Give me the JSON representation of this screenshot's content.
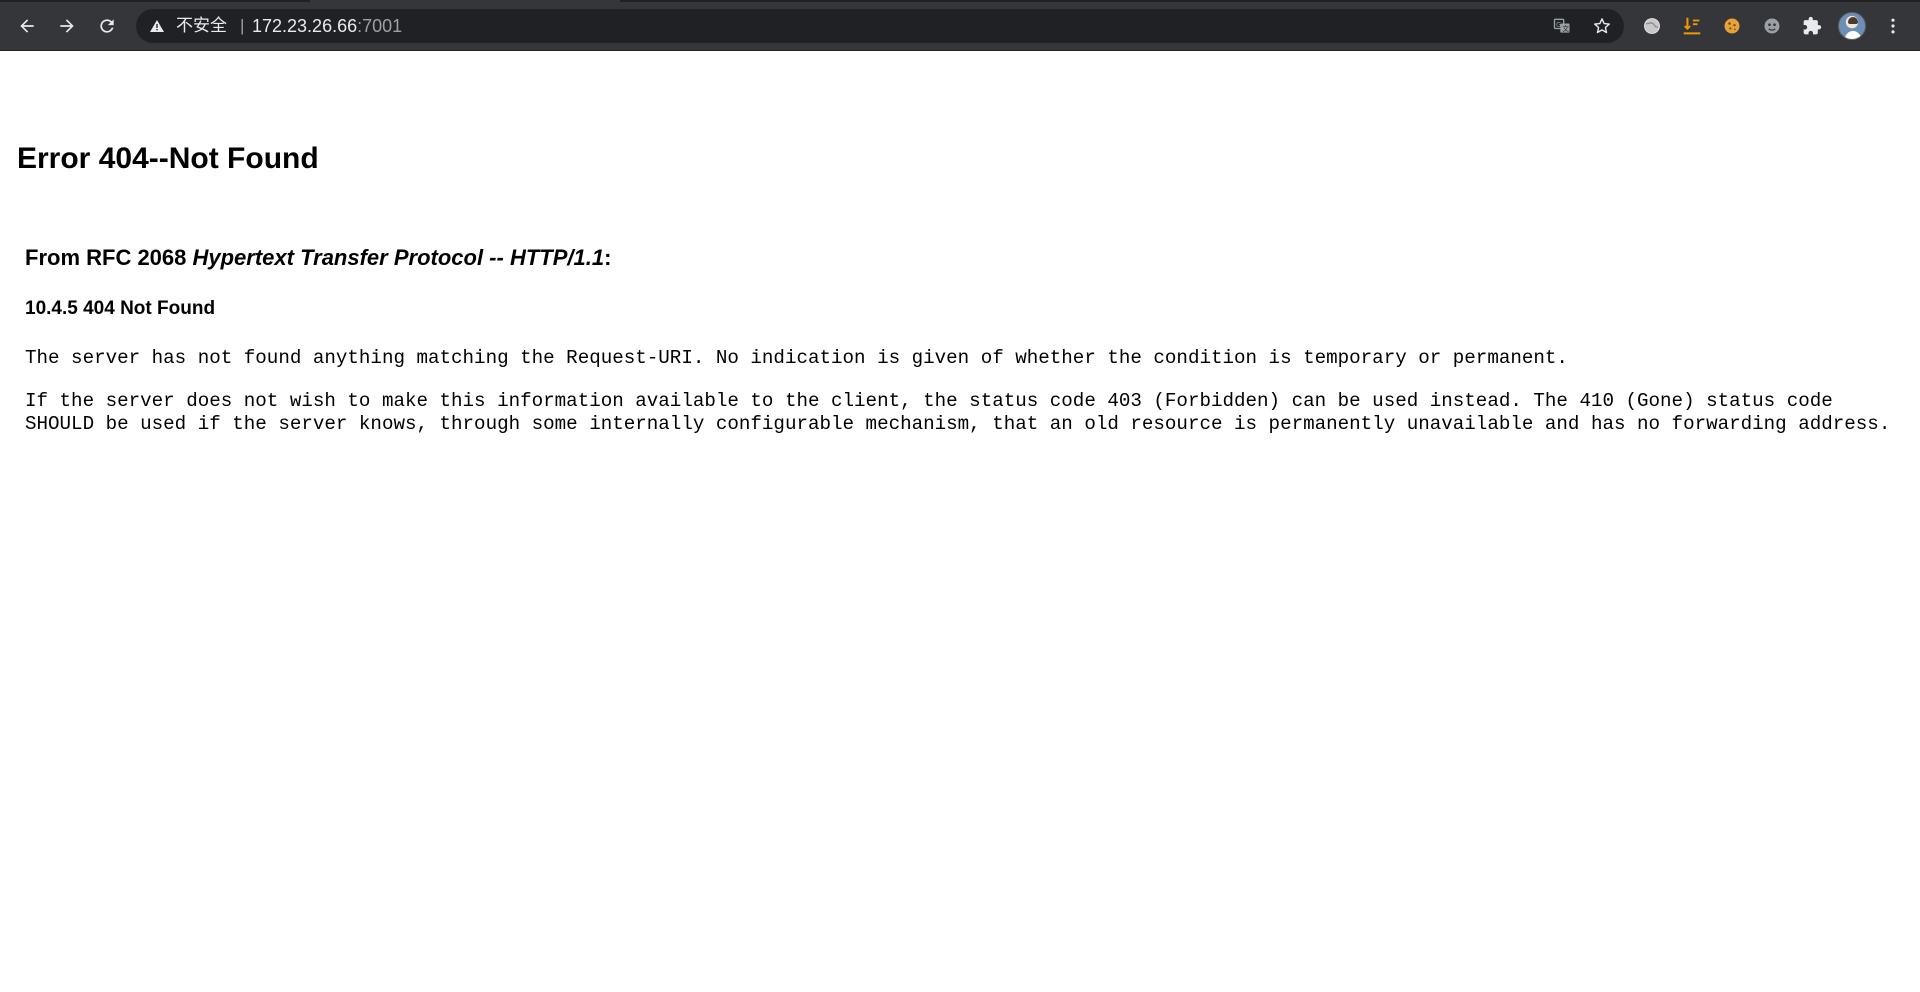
{
  "browser": {
    "security_label": "不安全",
    "separator": "|",
    "url_host": "172.23.26.66",
    "url_port": ":7001",
    "icons": {
      "back": "arrow-back-icon",
      "forward": "arrow-forward-icon",
      "reload": "reload-icon",
      "warning": "warning-triangle-icon",
      "translate": "translate-icon",
      "bookmark": "star-icon",
      "extensions": [
        "globe-extension-icon",
        "download-extension-icon",
        "cookie-extension-icon",
        "ghost-extension-icon",
        "puzzle-extensions-icon"
      ],
      "profile": "avatar",
      "menu": "kebab-menu-icon"
    },
    "colors": {
      "toolbar": "#35363a",
      "omnibox": "#202124",
      "text": "#e8eaed",
      "muted": "#9aa0a6"
    }
  },
  "page": {
    "title": "Error 404--Not Found",
    "rfc_heading_prefix": "From RFC 2068 ",
    "rfc_heading_italic": "Hypertext Transfer Protocol -- HTTP/1.1",
    "rfc_heading_suffix": ":",
    "section_heading": "10.4.5 404 Not Found",
    "paragraph1": "The server has not found anything matching the Request-URI. No indication is given of whether the condition is temporary or permanent.",
    "paragraph2": "If the server does not wish to make this information available to the client, the status code 403 (Forbidden) can be used instead. The 410 (Gone) status code SHOULD be used if the server knows, through some internally configurable mechanism, that an old resource is permanently unavailable and has no forwarding address."
  }
}
